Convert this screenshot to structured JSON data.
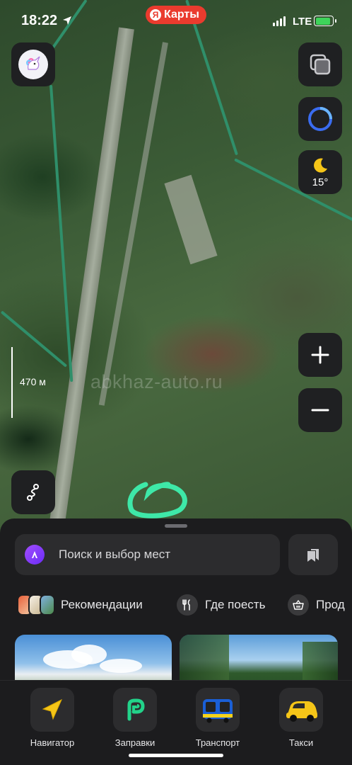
{
  "status_bar": {
    "time": "18:22",
    "app_label": "Карты",
    "app_logo": "Я",
    "network": "LTE",
    "battery_level": 0.9,
    "battery_color": "#3ed45a"
  },
  "map": {
    "scale_label": "470 м",
    "watermark": "abkhaz-auto.ru",
    "weather_temp": "15°",
    "weather_icon": "moon-icon",
    "marker_color": "#3ee8a8"
  },
  "search": {
    "placeholder": "Поиск и выбор мест"
  },
  "chips": [
    {
      "label": "Рекомендации",
      "icon": "recommendations-thumbs"
    },
    {
      "label": "Где поесть",
      "icon": "fork-knife-icon"
    },
    {
      "label": "Прод",
      "icon": "basket-icon"
    }
  ],
  "tabs": [
    {
      "label": "Навигатор",
      "icon": "navigator-arrow-icon"
    },
    {
      "label": "Заправки",
      "icon": "fuel-p-icon"
    },
    {
      "label": "Транспорт",
      "icon": "bus-icon"
    },
    {
      "label": "Такси",
      "icon": "taxi-car-icon"
    }
  ],
  "colors": {
    "accent": "#ea3b2e",
    "alice_purple": "#8a3ffc",
    "sheet_bg": "#1c1c1e"
  }
}
